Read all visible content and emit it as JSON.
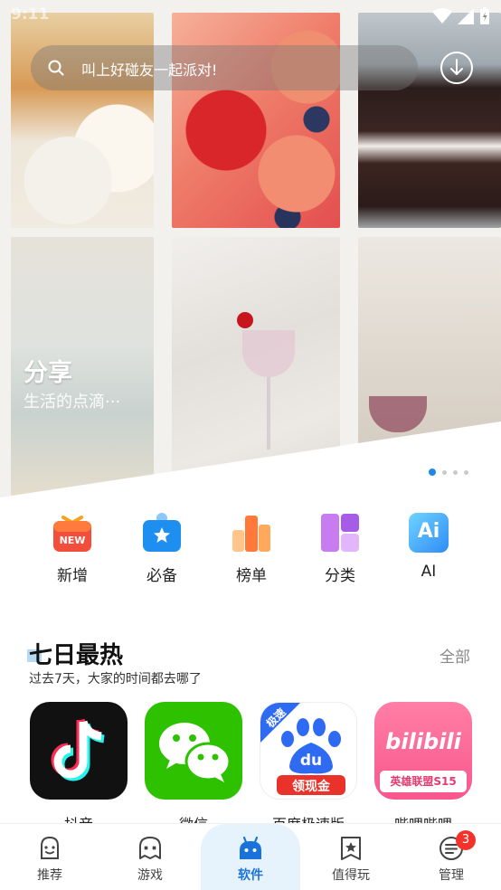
{
  "status_bar": {
    "time": "9:11"
  },
  "search": {
    "placeholder": "叫上好碰友一起派对!"
  },
  "hero": {
    "title": "分享",
    "subtitle": "生活的点滴···",
    "carousel_active_index": 0,
    "carousel_count": 4
  },
  "categories": [
    {
      "label": "新增",
      "icon": "new-icon",
      "badge_text": "NEW"
    },
    {
      "label": "必备",
      "icon": "essentials-icon"
    },
    {
      "label": "榜单",
      "icon": "ranking-icon"
    },
    {
      "label": "分类",
      "icon": "category-icon"
    },
    {
      "label": "AI",
      "icon": "ai-icon",
      "badge_text": "Ai"
    }
  ],
  "hot_section": {
    "title": "七日最热",
    "subtitle": "过去7天，大家的时间都去哪了",
    "more_label": "全部",
    "apps": [
      {
        "name": "抖音",
        "icon": "douyin-icon"
      },
      {
        "name": "微信",
        "icon": "wechat-icon"
      },
      {
        "name": "百度极速版",
        "icon": "baidu-lite-icon",
        "corner_label": "极速",
        "icon_text": "du",
        "banner_text": "领现金"
      },
      {
        "name": "哔哩哔哩",
        "icon": "bilibili-icon",
        "icon_text": "bilibili",
        "banner_text": "英雄联盟S15"
      }
    ]
  },
  "tab_bar": {
    "tabs": [
      {
        "label": "推荐",
        "icon": "recommend-icon"
      },
      {
        "label": "游戏",
        "icon": "game-icon"
      },
      {
        "label": "软件",
        "icon": "software-icon",
        "active": true
      },
      {
        "label": "值得玩",
        "icon": "worth-playing-icon"
      },
      {
        "label": "管理",
        "icon": "manage-icon",
        "badge": "3"
      }
    ]
  },
  "colors": {
    "accent": "#1a73d9",
    "active_tab_bg": "#e6f3fc",
    "badge": "#f3332b"
  }
}
